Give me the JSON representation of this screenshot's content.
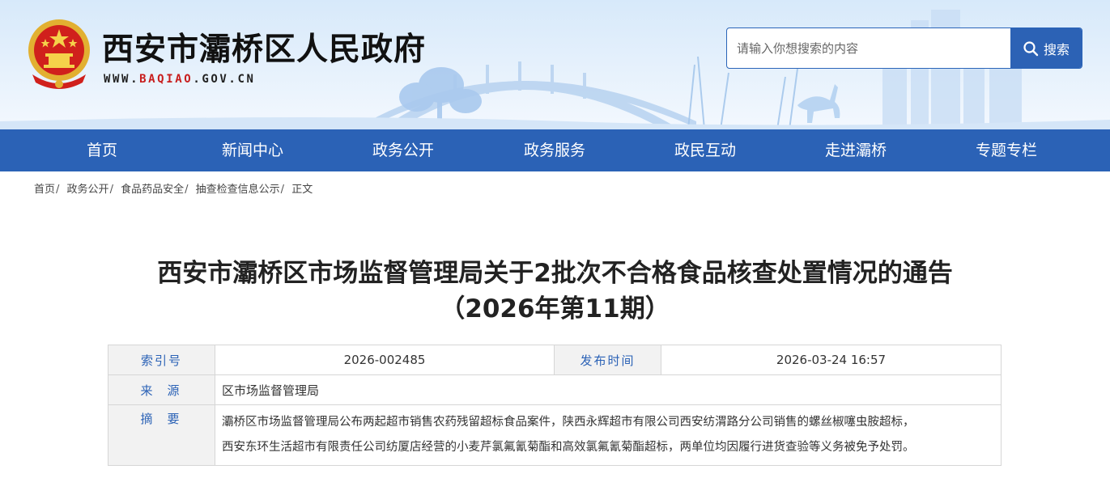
{
  "header": {
    "site_title": "西安市灞桥区人民政府",
    "url_prefix": "WWW.",
    "url_highlight": "BAQIAO",
    "url_suffix": ".GOV.CN",
    "search_placeholder": "请输入你想搜索的内容",
    "search_button": "搜索"
  },
  "nav": {
    "items": [
      "首页",
      "新闻中心",
      "政务公开",
      "政务服务",
      "政民互动",
      "走进灞桥",
      "专题专栏"
    ]
  },
  "breadcrumb": {
    "items": [
      "首页",
      "政务公开",
      "食品药品安全",
      "抽查检查信息公示",
      "正文"
    ],
    "separator": "/"
  },
  "article": {
    "title_line1": "西安市灞桥区市场监督管理局关于2批次不合格食品核查处置情况的通告",
    "title_line2": "（2026年第11期）"
  },
  "info": {
    "index_label": "索引号",
    "index_value": "2026-002485",
    "date_label": "发布时间",
    "date_value": "2026-03-24 16:57",
    "source_label": "来源",
    "source_value": "区市场监督管理局",
    "abstract_label": "摘要",
    "abstract_line1": "灞桥区市场监督管理局公布两起超市销售农药残留超标食品案件，陕西永辉超市有限公司西安纺渭路分公司销售的螺丝椒噻虫胺超标，",
    "abstract_line2": "西安东环生活超市有限责任公司纺厦店经营的小麦芹氯氟氰菊酯和高效氯氟氰菊酯超标，两单位均因履行进货查验等义务被免予处罚。"
  },
  "colors": {
    "nav_blue": "#2b62b6",
    "url_red": "#c81e1e",
    "label_blue": "#2b62b6"
  }
}
